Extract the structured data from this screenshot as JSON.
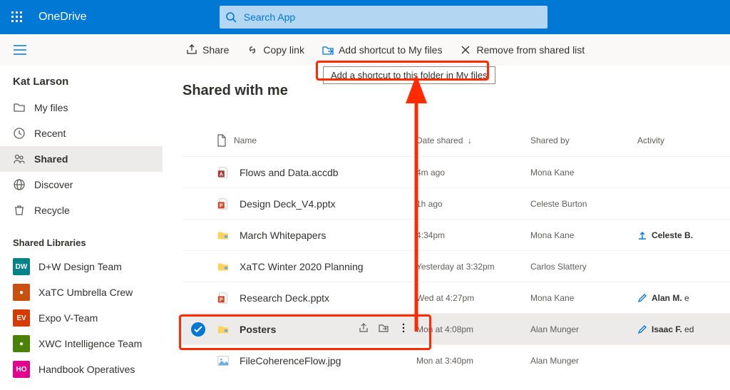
{
  "header": {
    "brand": "OneDrive",
    "search_placeholder": "Search App"
  },
  "commands": {
    "share": "Share",
    "copylink": "Copy link",
    "shortcut": "Add shortcut to My files",
    "remove": "Remove from shared list"
  },
  "tooltip": {
    "shortcut": "Add a shortcut to this folder in My files"
  },
  "nav": {
    "owner": "Kat Larson",
    "items": [
      {
        "label": "My files"
      },
      {
        "label": "Recent"
      },
      {
        "label": "Shared"
      },
      {
        "label": "Discover"
      },
      {
        "label": "Recycle"
      }
    ],
    "libs_title": "Shared Libraries",
    "libs": [
      {
        "badge": "DW",
        "color": "#038387",
        "label": "D+W Design Team"
      },
      {
        "badge": "",
        "color": "#ca5010",
        "label": "XaTC Umbrella Crew",
        "img": true
      },
      {
        "badge": "EV",
        "color": "#d83b01",
        "label": "Expo V-Team"
      },
      {
        "badge": "",
        "color": "#498205",
        "label": "XWC Intelligence Team",
        "img": true
      },
      {
        "badge": "HO",
        "color": "#e3008c",
        "label": "Handbook Operatives"
      }
    ]
  },
  "page": {
    "title": "Shared with me",
    "columns": {
      "name": "Name",
      "date": "Date shared",
      "sharedby": "Shared by",
      "activity": "Activity"
    }
  },
  "rows": [
    {
      "icon": "access",
      "name": "Flows and Data.accdb",
      "date": "4m ago",
      "by": "Mona Kane",
      "activity": null
    },
    {
      "icon": "pptx",
      "name": "Design Deck_V4.pptx",
      "date": "1h ago",
      "by": "Celeste Burton",
      "activity": null
    },
    {
      "icon": "folder",
      "name": "March Whitepapers",
      "date": "4:34pm",
      "by": "Mona Kane",
      "activity": {
        "icon": "upload",
        "who": "Celeste B.",
        "rest": ""
      }
    },
    {
      "icon": "folder",
      "name": "XaTC Winter 2020 Planning",
      "date": "Yesterday at 3:32pm",
      "by": "Carlos Slattery",
      "activity": null
    },
    {
      "icon": "pptx",
      "name": "Research Deck.pptx",
      "date": "Wed at 4:27pm",
      "by": "Mona Kane",
      "activity": {
        "icon": "edit",
        "who": "Alan M.",
        "rest": " e"
      }
    },
    {
      "icon": "folder",
      "name": "Posters",
      "date": "Mon at 4:08pm",
      "by": "Alan Munger",
      "selected": true,
      "activity": {
        "icon": "edit",
        "who": "Isaac F.",
        "rest": " ed"
      }
    },
    {
      "icon": "jpg",
      "name": "FileCoherenceFlow.jpg",
      "date": "Mon at 3:40pm",
      "by": "Alan Munger",
      "activity": null
    }
  ]
}
